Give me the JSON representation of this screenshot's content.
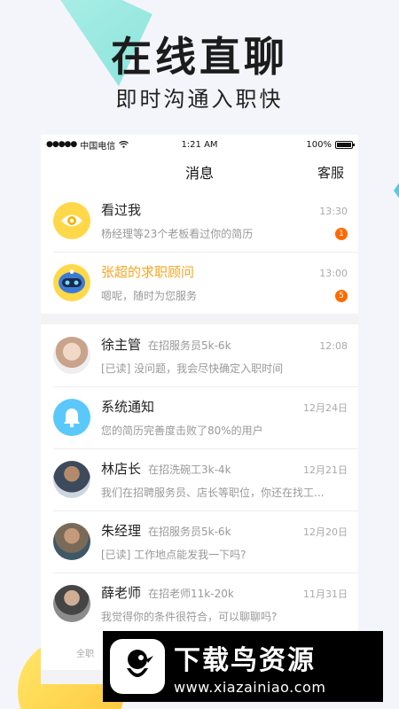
{
  "promo": {
    "headline": "在线直聊",
    "subheadline": "即时沟通入职快"
  },
  "status_bar": {
    "carrier": "中国电信",
    "time": "1:21 AM",
    "battery": "100%",
    "battery_level": 1.0
  },
  "nav": {
    "title": "消息",
    "right_action": "客服"
  },
  "top_items": [
    {
      "name": "看过我",
      "message": "杨经理等23个老板看过你的简历",
      "time": "13:30",
      "badge": "1",
      "icon": "eye-icon"
    },
    {
      "name": "张超的求职顾问",
      "message": "嗯呢，随时为您服务",
      "time": "13:00",
      "badge": "5",
      "icon": "robot-icon"
    }
  ],
  "conversations": [
    {
      "name": "徐主管",
      "job": "在招服务员5k-6k",
      "time": "12:08",
      "message": "[已读] 没问题，我会尽快确定入职时间"
    },
    {
      "name": "系统通知",
      "job": "",
      "time": "12月24日",
      "message": "您的简历完善度击败了80%的用户",
      "icon": "bell-icon"
    },
    {
      "name": "林店长",
      "job": "在招洗碗工3k-4k",
      "time": "12月21日",
      "message": "我们在招聘服务员、店长等职位，你还在找工..."
    },
    {
      "name": "朱经理",
      "job": "在招服务员5k-6k",
      "time": "12月20日",
      "message": "[已读] 工作地点能发我一下吗?"
    },
    {
      "name": "薛老师",
      "job": "在招老师11k-20k",
      "time": "11月31日",
      "message": "我觉得你的条件很符合，可以聊聊吗?"
    }
  ],
  "bottom_tab": {
    "label": "全职"
  },
  "watermark": {
    "title": "下载鸟资源",
    "url": "www.xiazainiao.com"
  },
  "colors": {
    "accent_orange": "#f5a623",
    "badge": "#ff6a00",
    "notify_blue": "#5ac8fa"
  }
}
